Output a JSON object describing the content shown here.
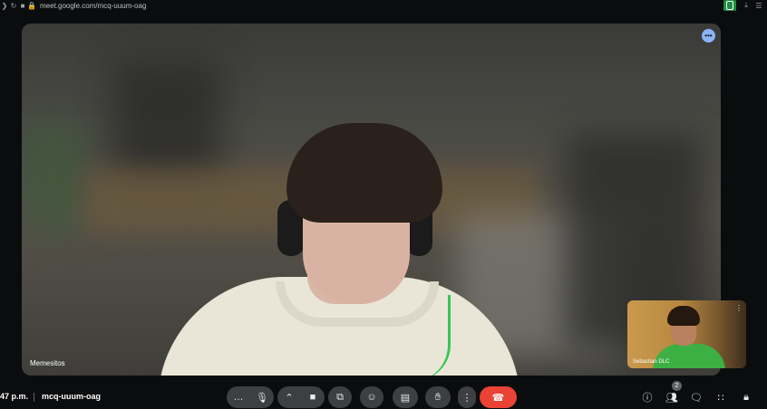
{
  "browser": {
    "url": "meet.google.com/mcq-uuum-oag",
    "icons": [
      "back-icon",
      "reload-icon",
      "video-indicator-icon",
      "lock-icon"
    ],
    "extension_color": "#1e8e3e"
  },
  "main_tile": {
    "participant_name": "Memesitos",
    "more_icon": "more-options-icon"
  },
  "self_tile": {
    "participant_name": "Sebastian DLC"
  },
  "bottom_bar": {
    "time": "47 p.m.",
    "meeting_code": "mcq-uuum-oag",
    "controls": {
      "more": "more-icon",
      "mic": "microphone-icon",
      "camera_options": "chevron-up-icon",
      "camera": "camera-icon",
      "present": "present-screen-icon",
      "reactions": "emoji-icon",
      "captions": "captions-icon",
      "raise_hand": "raise-hand-icon",
      "options": "vertical-dots-icon",
      "end_call": "end-call-icon"
    },
    "right": {
      "info": "info-icon",
      "people": "people-icon",
      "people_count": "2",
      "chat": "chat-icon",
      "activities": "apps-grid-icon",
      "host_controls": "lock-person-icon"
    }
  },
  "colors": {
    "end_call": "#ea4335",
    "control_bg": "#3c4043",
    "accent": "#8ab4f8"
  }
}
